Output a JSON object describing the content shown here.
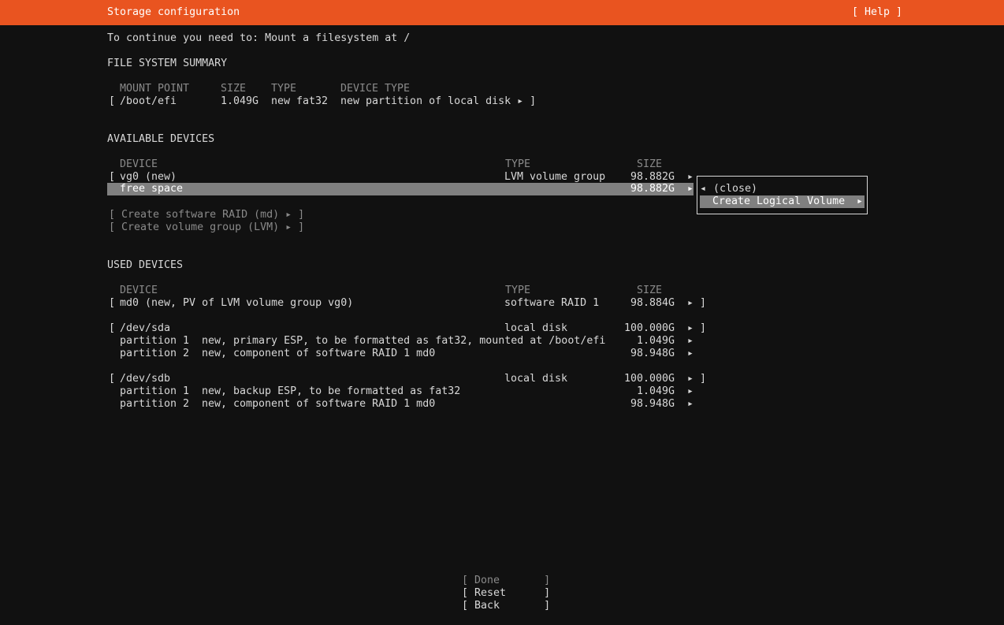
{
  "header": {
    "title": "Storage configuration",
    "help": "[ Help ]"
  },
  "instruction": "To continue you need to: Mount a filesystem at /",
  "fs_summary": {
    "heading": "FILE SYSTEM SUMMARY",
    "columns": {
      "mount_point": "MOUNT POINT",
      "size": "SIZE",
      "type": "TYPE",
      "device_type": "DEVICE TYPE"
    },
    "rows": [
      {
        "open": "[",
        "mount_point": "/boot/efi",
        "size": "1.049G",
        "type": "new fat32",
        "device_type": "new partition of local disk ▸ ]"
      }
    ]
  },
  "available": {
    "heading": "AVAILABLE DEVICES",
    "columns": {
      "device": "DEVICE",
      "type": "TYPE",
      "size": "SIZE"
    },
    "vg0": {
      "open": "[",
      "device": "vg0 (new)",
      "type": "LVM volume group",
      "size": "98.882G",
      "arrow": "▸"
    },
    "free": {
      "device": "free space",
      "size": "98.882G",
      "arrow": "▸"
    },
    "create_raid": "[ Create software RAID (md) ▸ ]",
    "create_lvm": "[ Create volume group (LVM) ▸ ]"
  },
  "popup": {
    "close_arrow": "◂",
    "close": "(close)",
    "create_lv": "Create Logical Volume",
    "create_lv_arrow": "▸"
  },
  "used": {
    "heading": "USED DEVICES",
    "columns": {
      "device": "DEVICE",
      "type": "TYPE",
      "size": "SIZE"
    },
    "md0": {
      "open": "[",
      "device": "md0 (new, PV of LVM volume group vg0)",
      "type": "software RAID 1",
      "size": "98.884G",
      "arrow": "▸ ]"
    },
    "sda": {
      "open": "[",
      "device": "/dev/sda",
      "type": "local disk",
      "size": "100.000G",
      "arrow": "▸ ]"
    },
    "sda_p1": {
      "name": "partition 1",
      "desc": "new, primary ESP, to be formatted as fat32, mounted at /boot/efi",
      "size": "1.049G",
      "arrow": "▸"
    },
    "sda_p2": {
      "name": "partition 2",
      "desc": "new, component of software RAID 1 md0",
      "size": "98.948G",
      "arrow": "▸"
    },
    "sdb": {
      "open": "[",
      "device": "/dev/sdb",
      "type": "local disk",
      "size": "100.000G",
      "arrow": "▸ ]"
    },
    "sdb_p1": {
      "name": "partition 1",
      "desc": "new, backup ESP, to be formatted as fat32",
      "size": "1.049G",
      "arrow": "▸"
    },
    "sdb_p2": {
      "name": "partition 2",
      "desc": "new, component of software RAID 1 md0",
      "size": "98.948G",
      "arrow": "▸"
    }
  },
  "buttons": {
    "done": "[ Done       ]",
    "reset": "[ Reset      ]",
    "back": "[ Back       ]"
  }
}
